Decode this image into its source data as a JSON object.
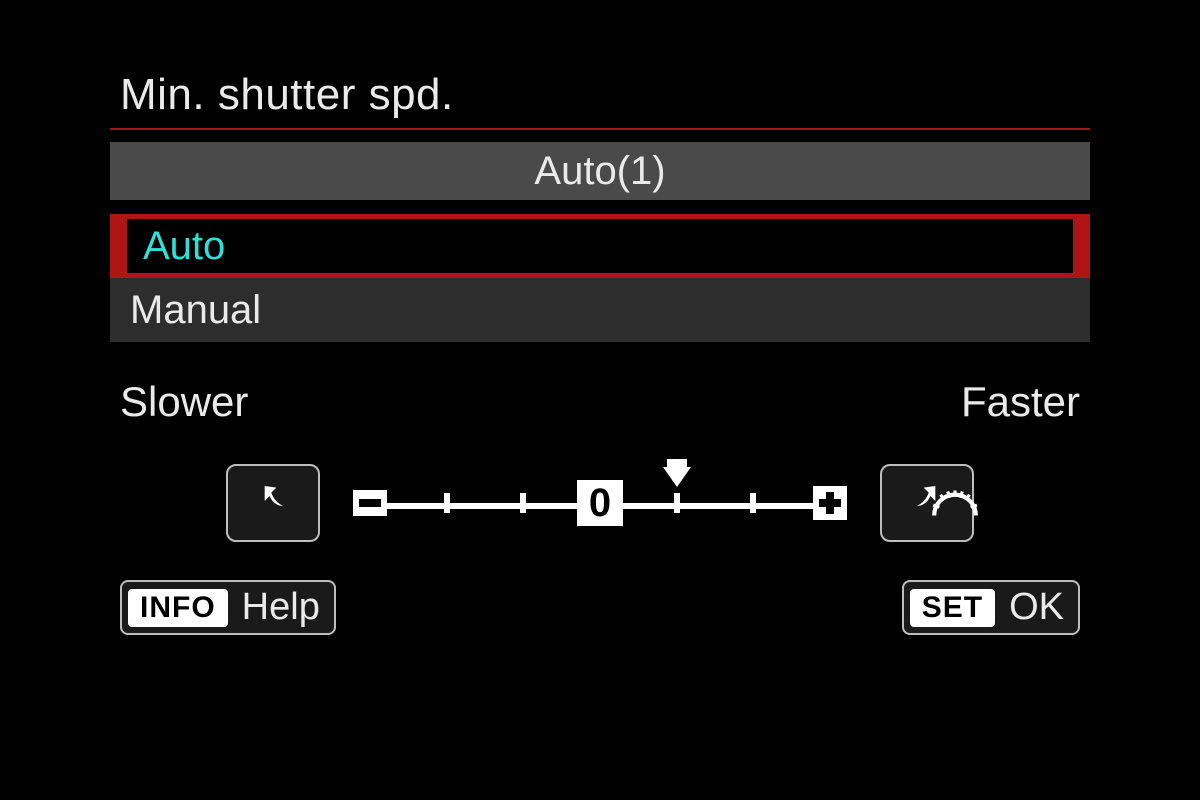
{
  "title": "Min. shutter spd.",
  "current_value": "Auto(1)",
  "options": {
    "auto": "Auto",
    "manual": "Manual"
  },
  "range_labels": {
    "slower": "Slower",
    "faster": "Faster"
  },
  "slider": {
    "min": -3,
    "max": 3,
    "center_label": "0",
    "pointer_position": 1
  },
  "footer": {
    "info_badge": "INFO",
    "help_label": "Help",
    "set_badge": "SET",
    "ok_label": "OK"
  }
}
